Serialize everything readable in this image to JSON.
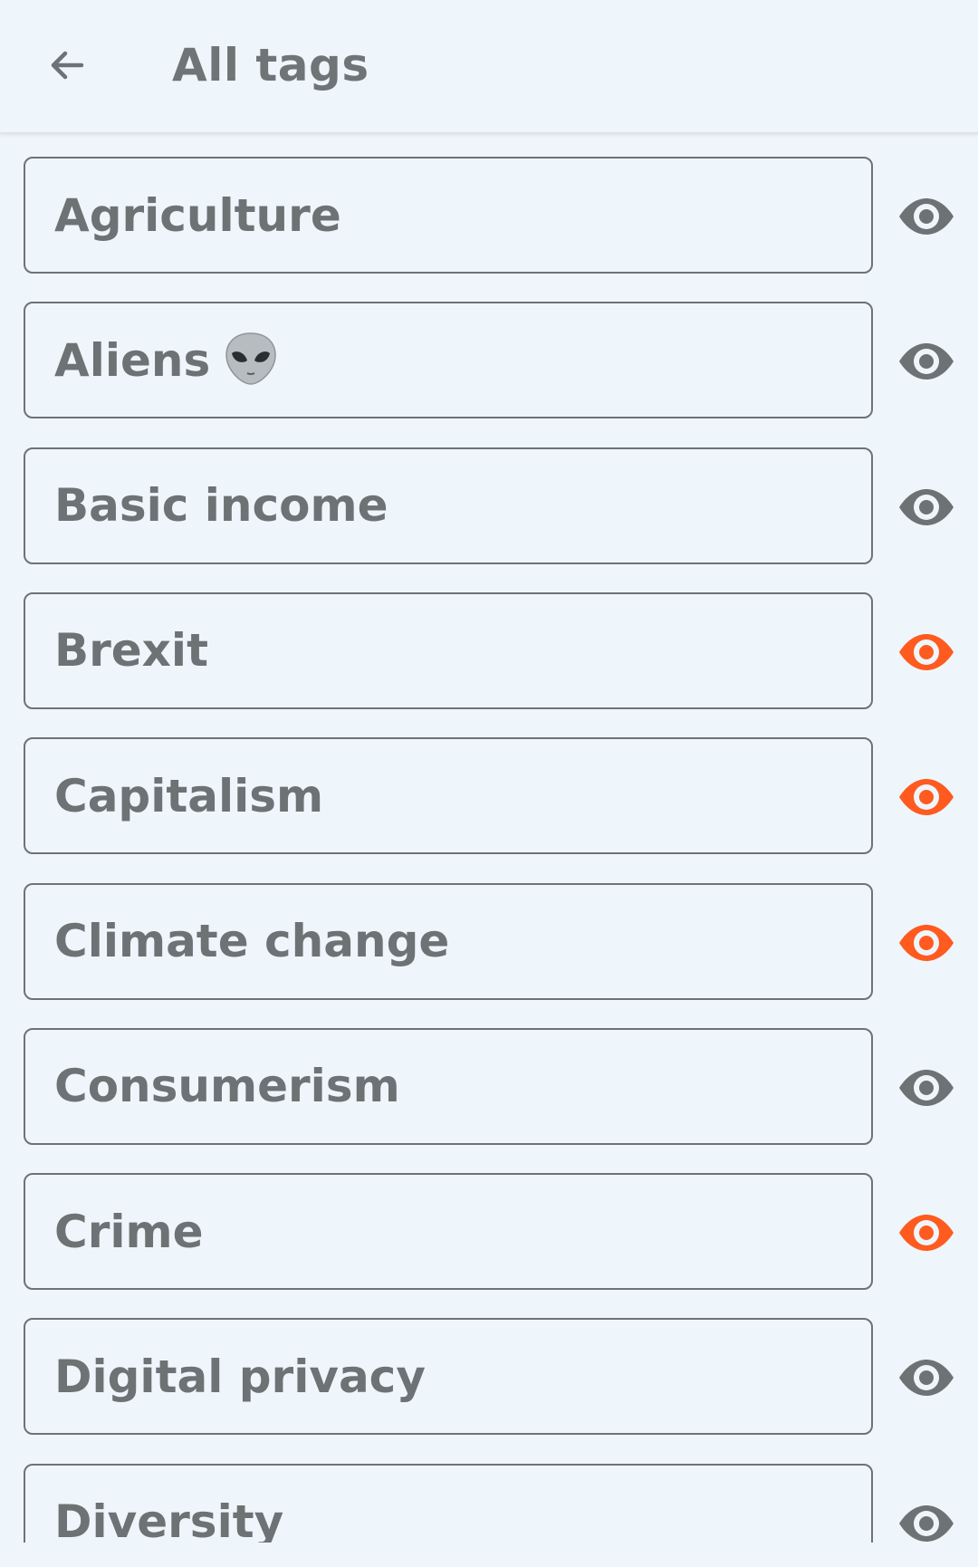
{
  "header": {
    "title": "All tags",
    "back_icon": "arrow-back-icon"
  },
  "colors": {
    "background": "#eff6fb",
    "text": "#6d7275",
    "eye_inactive": "#6d7275",
    "eye_active": "#ff5a1f"
  },
  "tags": [
    {
      "label": "Agriculture",
      "emoji_icon": null,
      "followed": false
    },
    {
      "label": "Aliens",
      "emoji_icon": "alien-emoji-icon",
      "followed": false
    },
    {
      "label": "Basic income",
      "emoji_icon": null,
      "followed": false
    },
    {
      "label": "Brexit",
      "emoji_icon": null,
      "followed": true
    },
    {
      "label": "Capitalism",
      "emoji_icon": null,
      "followed": true
    },
    {
      "label": "Climate change",
      "emoji_icon": null,
      "followed": true
    },
    {
      "label": "Consumerism",
      "emoji_icon": null,
      "followed": false
    },
    {
      "label": "Crime",
      "emoji_icon": null,
      "followed": true
    },
    {
      "label": "Digital privacy",
      "emoji_icon": null,
      "followed": false
    },
    {
      "label": "Diversity",
      "emoji_icon": null,
      "followed": false
    }
  ]
}
